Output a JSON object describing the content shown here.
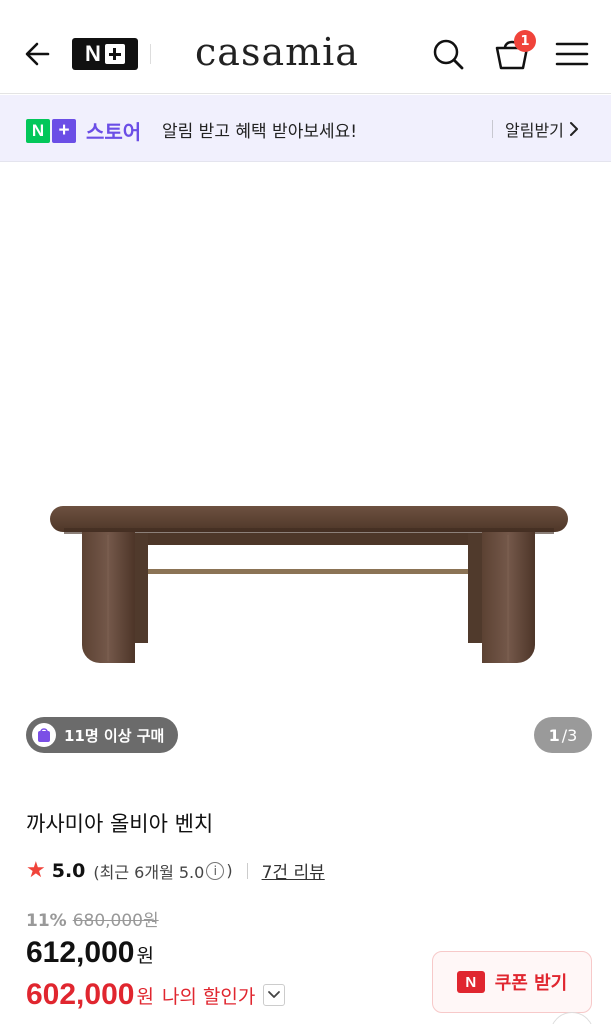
{
  "header": {
    "brand": "casamia",
    "nplus_logo_letter": "N",
    "cart_count": "1",
    "icons": {
      "back": "arrow-left-icon",
      "search": "search-icon",
      "cart": "shopping-bag-icon",
      "menu": "hamburger-menu-icon"
    }
  },
  "store_banner": {
    "logo_n": "N",
    "logo_plus": "+",
    "store_name": "스토어",
    "message": "알림 받고 혜택 받아보세요!",
    "action_label": "알림받기",
    "colors": {
      "accent": "#6b4ee6",
      "green": "#03c75a",
      "background": "#f1f0fd"
    }
  },
  "gallery": {
    "purchase_badge": "11명 이상 구매",
    "page_current": "1",
    "page_total": "/3",
    "image_description_icon": "wooden-bench-image"
  },
  "product": {
    "title": "까사미아 올비아 벤치",
    "rating_score": "5.0",
    "rating_recent_prefix": "(최근 6개월 5.0",
    "rating_recent_suffix": ")",
    "review_link": "7건 리뷰",
    "discount_rate": "11%",
    "original_price": "680,000원",
    "price": "612,000",
    "price_unit": "원",
    "my_price": "602,000",
    "my_price_unit": "원",
    "my_price_label": "나의 할인가",
    "coupon_label": "쿠폰 받기",
    "coupon_mark": "N",
    "colors": {
      "sale_red": "#e0262f",
      "star": "#f0433a"
    }
  }
}
